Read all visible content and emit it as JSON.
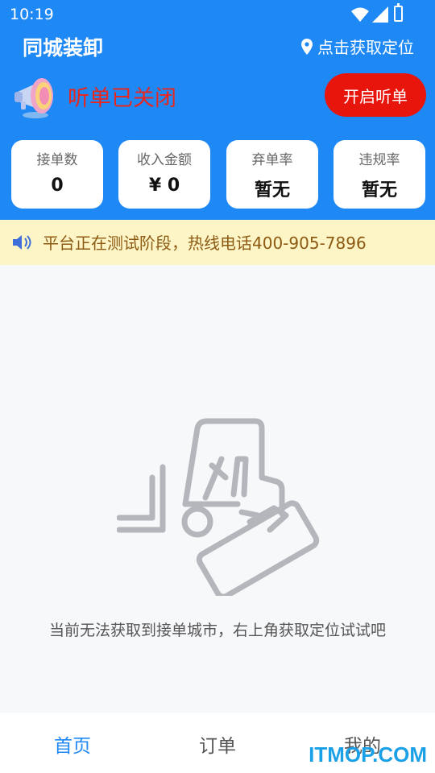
{
  "status_bar": {
    "time": "10:19"
  },
  "app": {
    "title": "同城装卸"
  },
  "location": {
    "label": "点击获取定位",
    "icon": "location-pin-icon"
  },
  "listening": {
    "status": "听单已关闭",
    "button_label": "开启听单",
    "status_color": "#e8271e"
  },
  "stats": [
    {
      "label": "接单数",
      "value": "0"
    },
    {
      "label": "收入金额",
      "value": "¥ 0"
    },
    {
      "label": "弃单率",
      "value": "暂无"
    },
    {
      "label": "违规率",
      "value": "暂无"
    }
  ],
  "notice": {
    "text": "平台正在测试阶段，热线电话400-905-7896",
    "icon": "speaker-icon"
  },
  "empty_state": {
    "icon": "forklift-clipboard-illustration",
    "message": "当前无法获取到接单城市，右上角获取定位试试吧"
  },
  "tabbar": {
    "tabs": [
      {
        "label": "首页",
        "active": true
      },
      {
        "label": "订单",
        "active": false
      },
      {
        "label": "我的",
        "active": false
      }
    ]
  },
  "watermark": {
    "text": "ITMOP.COM"
  },
  "colors": {
    "primary": "#1e88f5",
    "danger": "#e8150c",
    "notice_bg": "#fdf5c6"
  }
}
